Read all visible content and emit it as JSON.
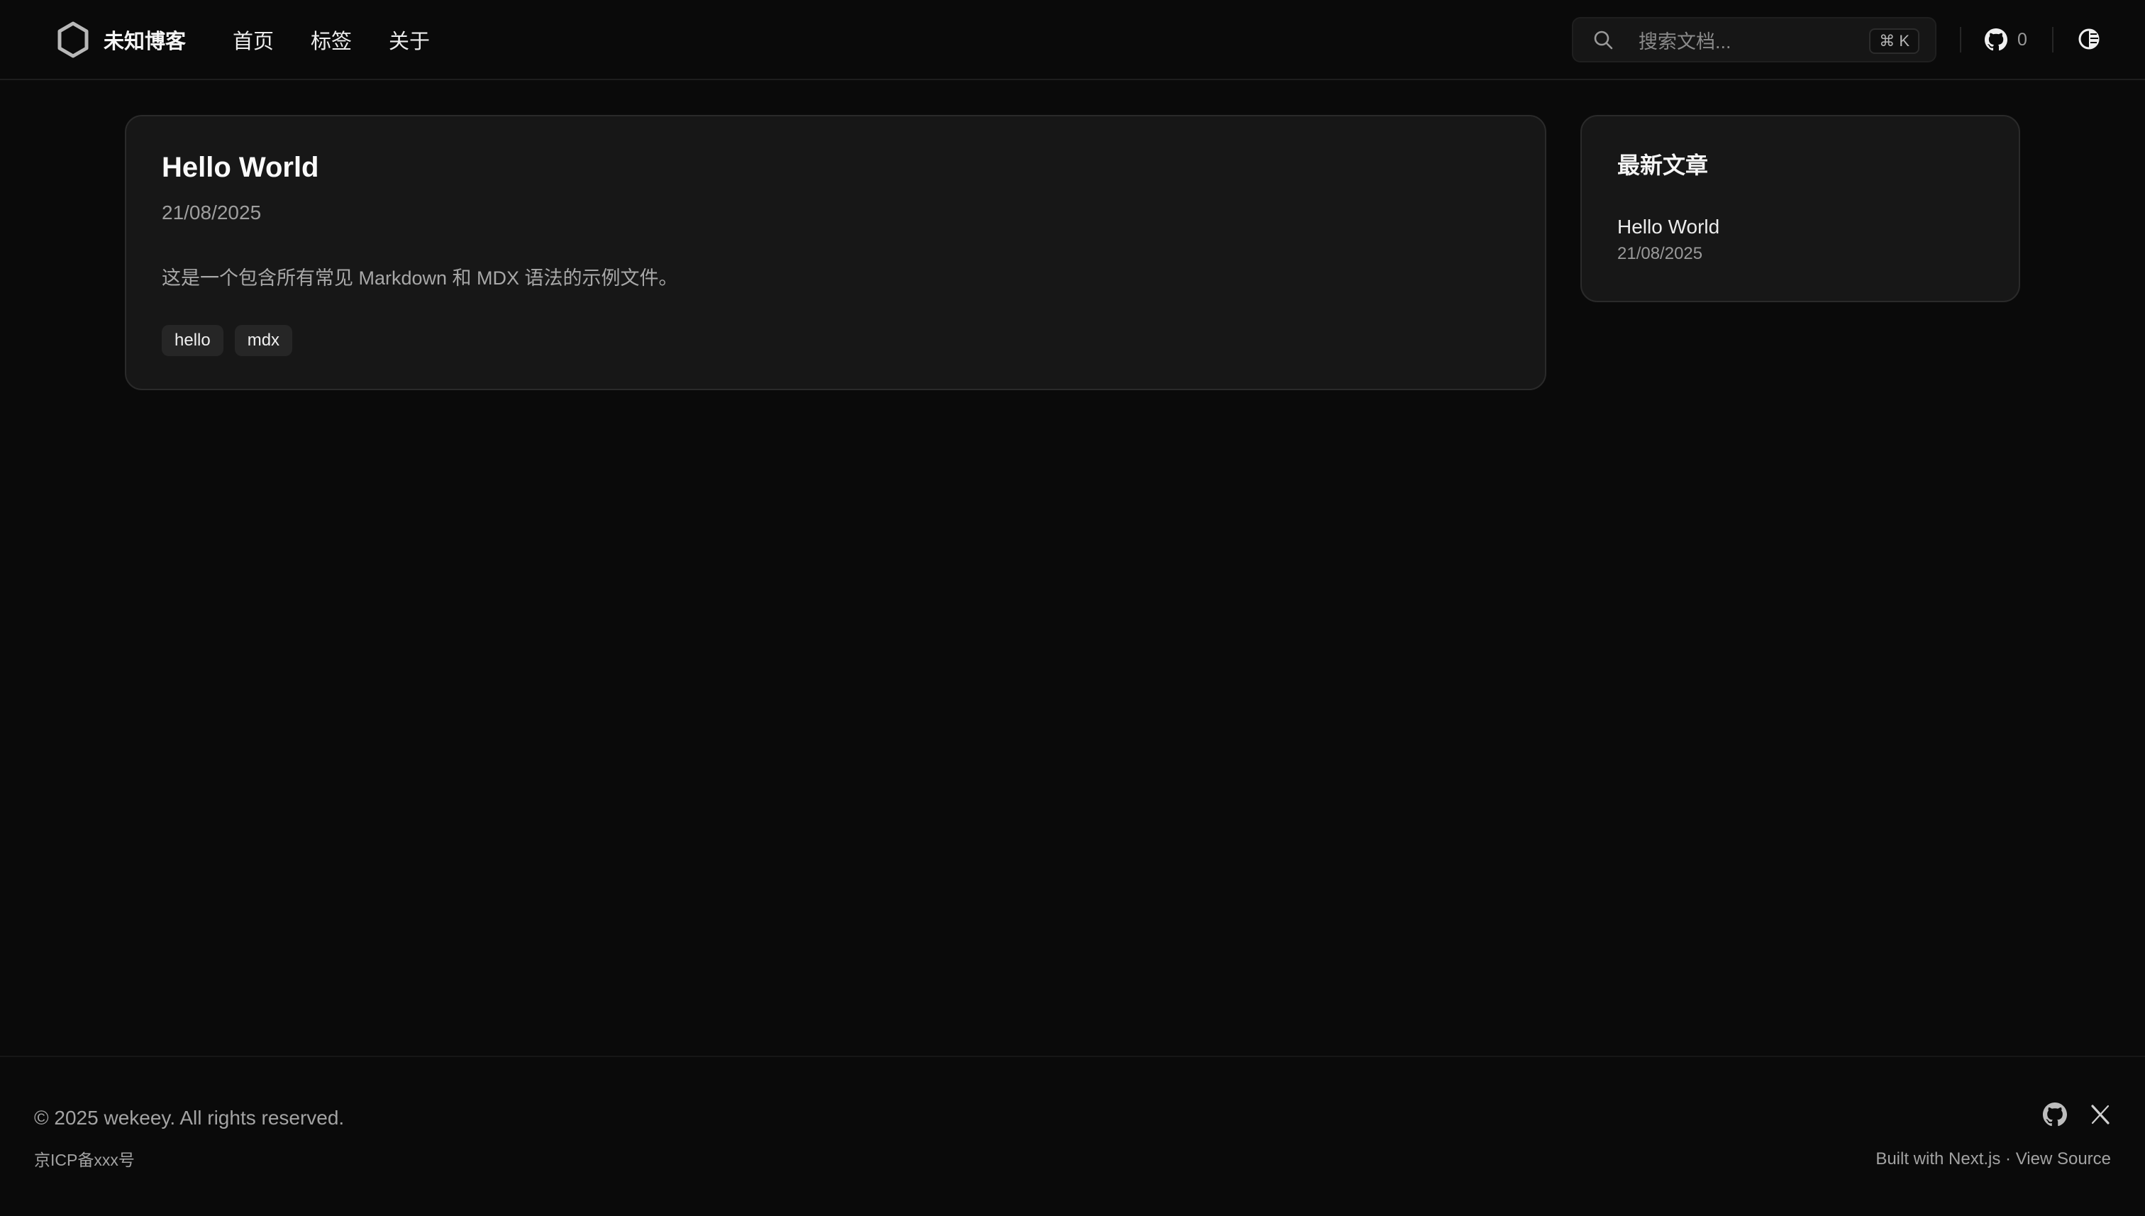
{
  "header": {
    "brand_name": "未知博客",
    "nav": [
      {
        "label": "首页"
      },
      {
        "label": "标签"
      },
      {
        "label": "关于"
      }
    ],
    "search": {
      "placeholder": "搜索文档...",
      "shortcut": "⌘ K"
    },
    "github_count": "0"
  },
  "main": {
    "post": {
      "title": "Hello World",
      "date": "21/08/2025",
      "description": "这是一个包含所有常见 Markdown 和 MDX 语法的示例文件。",
      "tags": [
        "hello",
        "mdx"
      ]
    }
  },
  "sidebar": {
    "title": "最新文章",
    "items": [
      {
        "title": "Hello World",
        "date": "21/08/2025"
      }
    ]
  },
  "footer": {
    "copyright": "© 2025 wekeey. All rights reserved.",
    "icp": "京ICP备xxx号",
    "built_with": "Built with Next.js",
    "dot": " · ",
    "view_source": "View Source"
  },
  "colors": {
    "background": "#0a0a0a",
    "card": "#171717",
    "border": "#2a2a2a",
    "text": "#f2f2f2",
    "muted": "#a3a3a3"
  }
}
